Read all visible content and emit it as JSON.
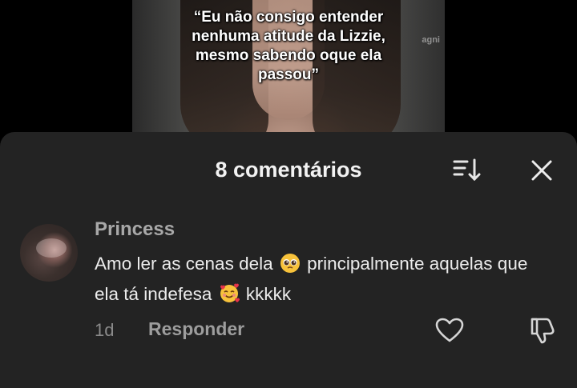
{
  "video": {
    "caption": "“Eu não consigo entender nenhuma atitude da Lizzie, mesmo sabendo oque ela passou”",
    "caption_lines": [
      "“Eu não consigo entender",
      "nenhuma atitude da Lizzie,",
      "mesmo sabendo oque ela",
      "passou”"
    ],
    "watermark": "agni"
  },
  "comments_sheet": {
    "title": "8 comentários",
    "sort_icon": "sort-descending-icon",
    "close_icon": "close-icon",
    "background": "#232323"
  },
  "comments": [
    {
      "username": "Princess",
      "text_part1": "Amo ler as cenas dela",
      "emoji1": "pleading-face",
      "text_part2": "principalmente aquelas que ela tá indefesa",
      "emoji2": "smiling-face-with-hearts",
      "text_part3": "kkkkk",
      "time": "1d",
      "reply_label": "Responder",
      "like_icon": "heart-outline-icon",
      "dislike_icon": "thumbs-down-icon"
    }
  ]
}
